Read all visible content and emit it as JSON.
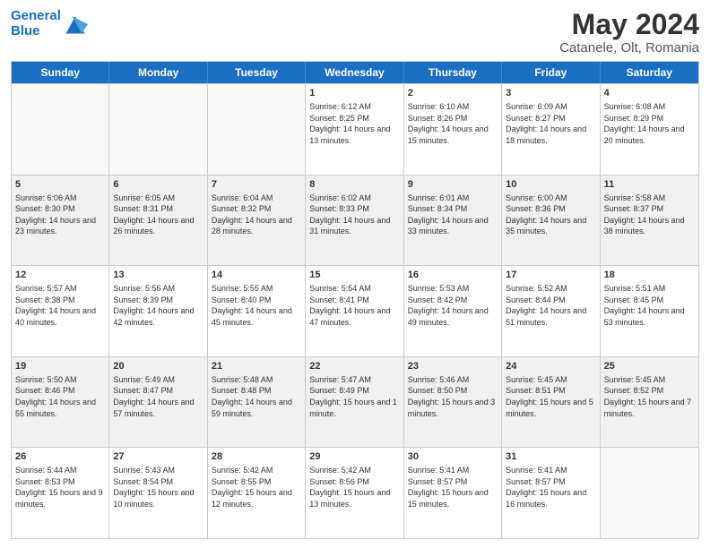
{
  "header": {
    "logo_line1": "General",
    "logo_line2": "Blue",
    "title": "May 2024",
    "subtitle": "Catanele, Olt, Romania"
  },
  "days": [
    "Sunday",
    "Monday",
    "Tuesday",
    "Wednesday",
    "Thursday",
    "Friday",
    "Saturday"
  ],
  "rows": [
    [
      {
        "day": "",
        "info": ""
      },
      {
        "day": "",
        "info": ""
      },
      {
        "day": "",
        "info": ""
      },
      {
        "day": "1",
        "info": "Sunrise: 6:12 AM\nSunset: 8:25 PM\nDaylight: 14 hours and 13 minutes."
      },
      {
        "day": "2",
        "info": "Sunrise: 6:10 AM\nSunset: 8:26 PM\nDaylight: 14 hours and 15 minutes."
      },
      {
        "day": "3",
        "info": "Sunrise: 6:09 AM\nSunset: 8:27 PM\nDaylight: 14 hours and 18 minutes."
      },
      {
        "day": "4",
        "info": "Sunrise: 6:08 AM\nSunset: 8:29 PM\nDaylight: 14 hours and 20 minutes."
      }
    ],
    [
      {
        "day": "5",
        "info": "Sunrise: 6:06 AM\nSunset: 8:30 PM\nDaylight: 14 hours and 23 minutes."
      },
      {
        "day": "6",
        "info": "Sunrise: 6:05 AM\nSunset: 8:31 PM\nDaylight: 14 hours and 26 minutes."
      },
      {
        "day": "7",
        "info": "Sunrise: 6:04 AM\nSunset: 8:32 PM\nDaylight: 14 hours and 28 minutes."
      },
      {
        "day": "8",
        "info": "Sunrise: 6:02 AM\nSunset: 8:33 PM\nDaylight: 14 hours and 31 minutes."
      },
      {
        "day": "9",
        "info": "Sunrise: 6:01 AM\nSunset: 8:34 PM\nDaylight: 14 hours and 33 minutes."
      },
      {
        "day": "10",
        "info": "Sunrise: 6:00 AM\nSunset: 8:36 PM\nDaylight: 14 hours and 35 minutes."
      },
      {
        "day": "11",
        "info": "Sunrise: 5:58 AM\nSunset: 8:37 PM\nDaylight: 14 hours and 38 minutes."
      }
    ],
    [
      {
        "day": "12",
        "info": "Sunrise: 5:57 AM\nSunset: 8:38 PM\nDaylight: 14 hours and 40 minutes."
      },
      {
        "day": "13",
        "info": "Sunrise: 5:56 AM\nSunset: 8:39 PM\nDaylight: 14 hours and 42 minutes."
      },
      {
        "day": "14",
        "info": "Sunrise: 5:55 AM\nSunset: 8:40 PM\nDaylight: 14 hours and 45 minutes."
      },
      {
        "day": "15",
        "info": "Sunrise: 5:54 AM\nSunset: 8:41 PM\nDaylight: 14 hours and 47 minutes."
      },
      {
        "day": "16",
        "info": "Sunrise: 5:53 AM\nSunset: 8:42 PM\nDaylight: 14 hours and 49 minutes."
      },
      {
        "day": "17",
        "info": "Sunrise: 5:52 AM\nSunset: 8:44 PM\nDaylight: 14 hours and 51 minutes."
      },
      {
        "day": "18",
        "info": "Sunrise: 5:51 AM\nSunset: 8:45 PM\nDaylight: 14 hours and 53 minutes."
      }
    ],
    [
      {
        "day": "19",
        "info": "Sunrise: 5:50 AM\nSunset: 8:46 PM\nDaylight: 14 hours and 55 minutes."
      },
      {
        "day": "20",
        "info": "Sunrise: 5:49 AM\nSunset: 8:47 PM\nDaylight: 14 hours and 57 minutes."
      },
      {
        "day": "21",
        "info": "Sunrise: 5:48 AM\nSunset: 8:48 PM\nDaylight: 14 hours and 59 minutes."
      },
      {
        "day": "22",
        "info": "Sunrise: 5:47 AM\nSunset: 8:49 PM\nDaylight: 15 hours and 1 minute."
      },
      {
        "day": "23",
        "info": "Sunrise: 5:46 AM\nSunset: 8:50 PM\nDaylight: 15 hours and 3 minutes."
      },
      {
        "day": "24",
        "info": "Sunrise: 5:45 AM\nSunset: 8:51 PM\nDaylight: 15 hours and 5 minutes."
      },
      {
        "day": "25",
        "info": "Sunrise: 5:45 AM\nSunset: 8:52 PM\nDaylight: 15 hours and 7 minutes."
      }
    ],
    [
      {
        "day": "26",
        "info": "Sunrise: 5:44 AM\nSunset: 8:53 PM\nDaylight: 15 hours and 9 minutes."
      },
      {
        "day": "27",
        "info": "Sunrise: 5:43 AM\nSunset: 8:54 PM\nDaylight: 15 hours and 10 minutes."
      },
      {
        "day": "28",
        "info": "Sunrise: 5:42 AM\nSunset: 8:55 PM\nDaylight: 15 hours and 12 minutes."
      },
      {
        "day": "29",
        "info": "Sunrise: 5:42 AM\nSunset: 8:56 PM\nDaylight: 15 hours and 13 minutes."
      },
      {
        "day": "30",
        "info": "Sunrise: 5:41 AM\nSunset: 8:57 PM\nDaylight: 15 hours and 15 minutes."
      },
      {
        "day": "31",
        "info": "Sunrise: 5:41 AM\nSunset: 8:57 PM\nDaylight: 15 hours and 16 minutes."
      },
      {
        "day": "",
        "info": ""
      }
    ]
  ]
}
